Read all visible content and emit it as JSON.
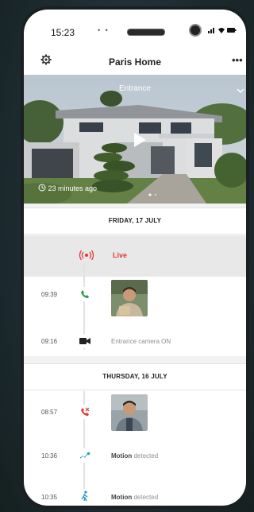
{
  "status_bar": {
    "time": "15:23"
  },
  "header": {
    "title": "Paris Home"
  },
  "video": {
    "camera_name": "Entrance",
    "time_ago": "23 minutes ago"
  },
  "days": [
    {
      "label": "FRIDAY, 17 JULY"
    },
    {
      "label": "THURSDAY, 16 JULY"
    }
  ],
  "live": {
    "label": "Live"
  },
  "events": [
    {
      "time": "09:39",
      "icon": "phone-answered-icon"
    },
    {
      "time": "09:16",
      "icon": "video-camera-icon",
      "text": "Entrance camera ON"
    },
    {
      "time": "08:57",
      "icon": "phone-missed-icon"
    },
    {
      "time": "10:36",
      "icon": "motion-icon",
      "strong": "Motion",
      "text": "detected"
    },
    {
      "time": "10:35",
      "icon": "person-walking-icon",
      "strong": "Motion",
      "text": "detected"
    }
  ],
  "colors": {
    "accent_red": "#e53935",
    "call_green": "#2e9e47",
    "motion_blue": "#2a9bb8"
  }
}
